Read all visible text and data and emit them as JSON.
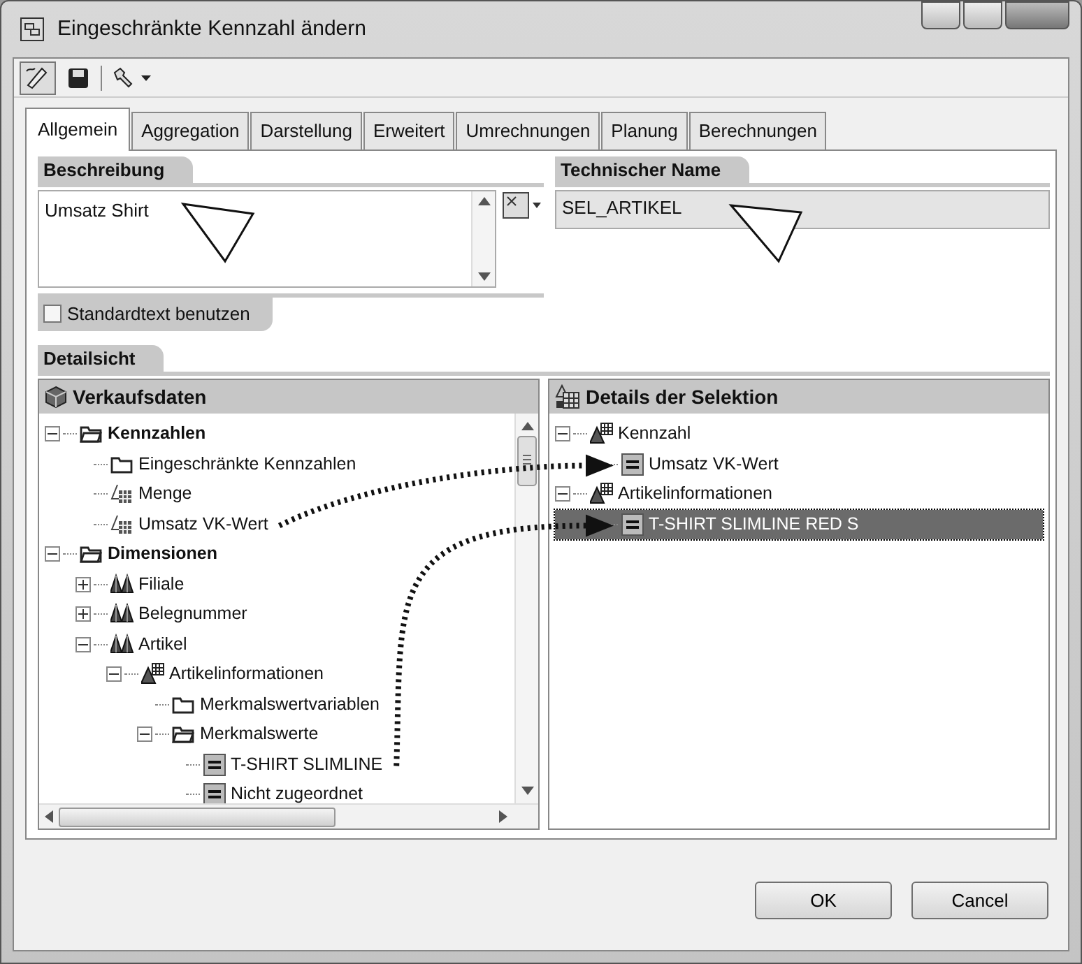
{
  "window": {
    "title": "Eingeschränkte Kennzahl ändern"
  },
  "toolbar": [
    {
      "kind": "pen",
      "pressed": true
    },
    {
      "kind": "save",
      "pressed": false
    },
    {
      "kind": "tools",
      "pressed": false
    }
  ],
  "tabs": [
    {
      "label": "Allgemein",
      "selected": true
    },
    {
      "label": "Aggregation",
      "selected": false
    },
    {
      "label": "Darstellung",
      "selected": false
    },
    {
      "label": "Erweitert",
      "selected": false
    },
    {
      "label": "Umrechnungen",
      "selected": false
    },
    {
      "label": "Planung",
      "selected": false
    },
    {
      "label": "Berechnungen",
      "selected": false
    }
  ],
  "description": {
    "heading": "Beschreibung",
    "value": "Umsatz Shirt",
    "checkbox": {
      "label": "Standardtext benutzen",
      "checked": false
    }
  },
  "technical_name": {
    "heading": "Technischer Name",
    "value": "SEL_ARTIKEL"
  },
  "detail_view": {
    "heading": "Detailsicht",
    "left": {
      "title": "Verkaufsdaten",
      "root_bold": true,
      "nodes": [
        {
          "label": "Kennzahlen",
          "kind": "folder-open",
          "expanded": true,
          "selected": false,
          "children": [
            {
              "label": "Eingeschränkte Kennzahlen",
              "kind": "folder",
              "selected": false
            },
            {
              "label": "Menge",
              "kind": "keyfigure",
              "selected": false
            },
            {
              "label": "Umsatz VK-Wert",
              "kind": "keyfigure",
              "selected": false
            }
          ]
        },
        {
          "label": "Dimensionen",
          "kind": "folder-open",
          "expanded": true,
          "selected": false,
          "children": [
            {
              "label": "Filiale",
              "kind": "characteristic",
              "expanded": false,
              "selected": false
            },
            {
              "label": "Belegnummer",
              "kind": "characteristic",
              "expanded": false,
              "selected": false
            },
            {
              "label": "Artikel",
              "kind": "characteristic",
              "expanded": true,
              "selected": false,
              "children": [
                {
                  "label": "Artikelinformationen",
                  "kind": "structure",
                  "expanded": true,
                  "selected": false,
                  "children": [
                    {
                      "label": "Merkmalswertvariablen",
                      "kind": "folder",
                      "selected": false
                    },
                    {
                      "label": "Merkmalswerte",
                      "kind": "folder-open",
                      "expanded": true,
                      "selected": false,
                      "children": [
                        {
                          "label": "T-SHIRT SLIMLINE",
                          "kind": "value",
                          "selected": false
                        },
                        {
                          "label": "Nicht zugeordnet",
                          "kind": "value",
                          "selected": false
                        }
                      ]
                    }
                  ]
                }
              ]
            }
          ]
        }
      ]
    },
    "right": {
      "title": "Details der Selektion",
      "root_bold": false,
      "nodes": [
        {
          "label": "Kennzahl",
          "kind": "structure",
          "expanded": true,
          "selected": false,
          "children": [
            {
              "label": "Umsatz VK-Wert",
              "kind": "value",
              "selected": false
            }
          ]
        },
        {
          "label": "Artikelinformationen",
          "kind": "structure",
          "expanded": true,
          "selected": false,
          "children": [
            {
              "label": "T-SHIRT SLIMLINE RED S",
              "kind": "value",
              "selected": true
            }
          ]
        }
      ]
    }
  },
  "buttons": [
    "OK",
    "Cancel"
  ]
}
